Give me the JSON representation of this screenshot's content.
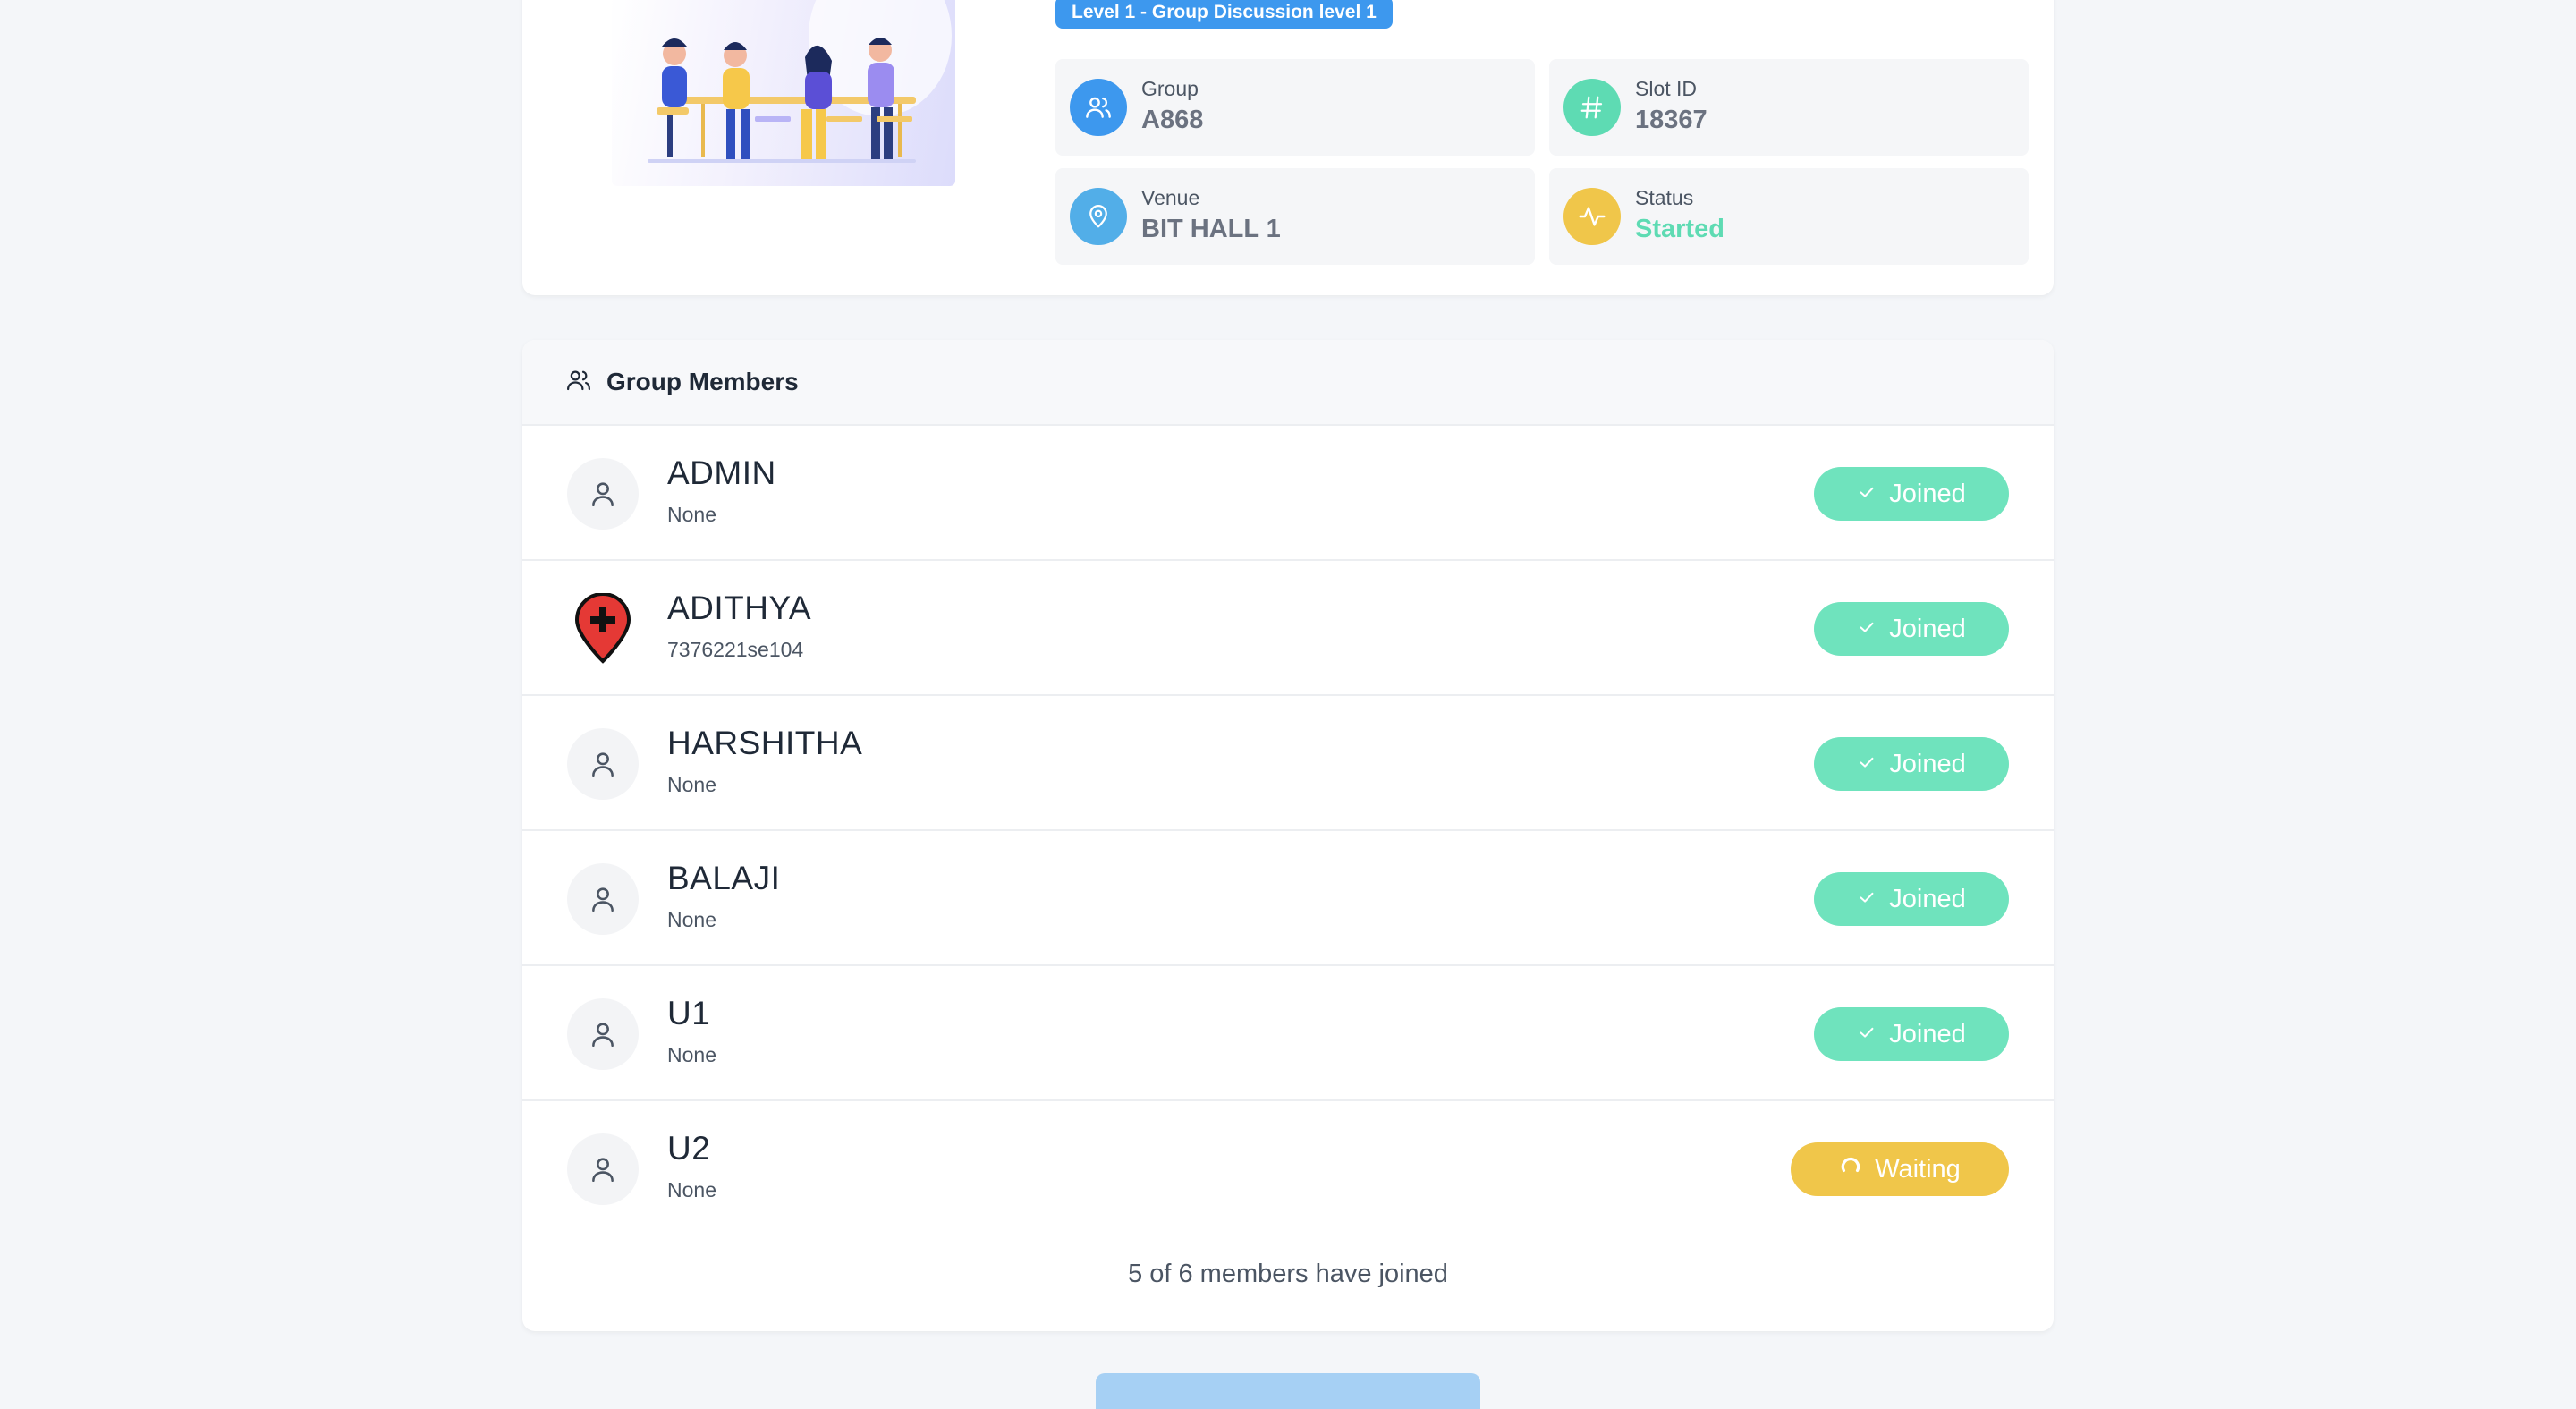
{
  "session": {
    "level_badge": "Level 1 - Group Discussion level 1",
    "group_label": "Group",
    "group_value": "A868",
    "slot_label": "Slot ID",
    "slot_value": "18367",
    "venue_label": "Venue",
    "venue_value": "BIT HALL 1",
    "status_label": "Status",
    "status_value": "Started"
  },
  "members_panel": {
    "title": "Group Members",
    "members": [
      {
        "name": "ADMIN",
        "sub": "None",
        "status": "Joined",
        "avatar": "user-icon"
      },
      {
        "name": "ADITHYA",
        "sub": "7376221se104",
        "status": "Joined",
        "avatar": "location-pin-plus-icon"
      },
      {
        "name": "HARSHITHA",
        "sub": "None",
        "status": "Joined",
        "avatar": "user-icon"
      },
      {
        "name": "BALAJI",
        "sub": "None",
        "status": "Joined",
        "avatar": "user-icon"
      },
      {
        "name": "U1",
        "sub": "None",
        "status": "Joined",
        "avatar": "user-icon"
      },
      {
        "name": "U2",
        "sub": "None",
        "status": "Waiting",
        "avatar": "user-icon"
      }
    ],
    "footer": "5 of 6 members have joined"
  },
  "colors": {
    "accent_blue": "#3d98ee",
    "joined_green": "#6fe3bd",
    "waiting_yellow": "#f0c64a",
    "status_started": "#5edbb3"
  }
}
